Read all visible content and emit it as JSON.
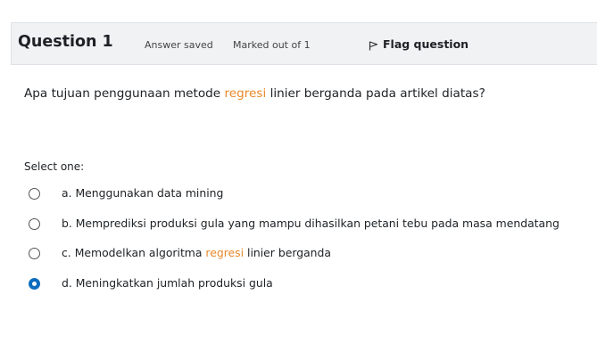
{
  "question": {
    "title": "Question 1",
    "state": "Answer saved",
    "grade": "Marked out of 1",
    "flag_label": "Flag question",
    "text_before": "Apa tujuan penggunaan metode ",
    "text_highlight": "regresi",
    "text_after": " linier berganda pada artikel diatas?",
    "prompt": "Select one:",
    "highlight_color": "#e8892b",
    "accent_color": "#0f6cbf"
  },
  "options": [
    {
      "text": "a. Menggunakan data mining",
      "selected": false
    },
    {
      "text": "b. Memprediksi produksi gula yang mampu dihasilkan petani tebu pada masa mendatang",
      "selected": false
    },
    {
      "text_before": "c. Memodelkan algoritma ",
      "text_highlight": "regresi",
      "text_after": " linier berganda",
      "selected": false
    },
    {
      "text": "d. Meningkatkan jumlah produksi gula",
      "selected": true
    }
  ]
}
